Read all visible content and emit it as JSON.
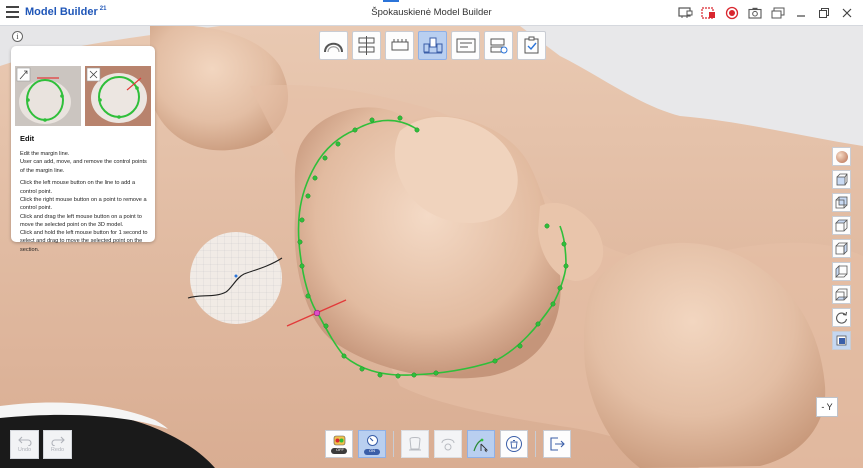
{
  "titlebar": {
    "app_name": "Model Builder",
    "app_badge": "21",
    "window_title": "Špokauskienė Model Builder"
  },
  "colors": {
    "accent": "#2b74d9",
    "model": "#e8c6ae",
    "margin_line": "#2fbf3a",
    "record": "#d9262e"
  },
  "top_toolbar": {
    "tools": [
      "arch-tool",
      "occlusion-tool",
      "model-base-tool",
      "die-tool",
      "label-tool",
      "inspect-tool",
      "finish-tool"
    ],
    "active_index": 3
  },
  "help": {
    "info_glyph": "i",
    "title": "Edit",
    "paragraphs": [
      "Edit the margin line.\nUser can add, move, and remove the control points of the margin line.",
      "Click the left mouse button on the line to add a control point.\nClick the right mouse button on a point to remove a control point.\nClick and drag the left mouse button on a point to move the selected point on the 3D model.\nClick and hold the left mouse button for 1 second to select and drag to move the selected point on the section."
    ]
  },
  "view": {
    "axis_label": "- Y"
  },
  "undo_redo": {
    "undo_label": "Undo",
    "redo_label": "Redo"
  },
  "bottom_toolbar": {
    "toggle_off_label": "OFF",
    "toggle_on_label": "ON"
  }
}
